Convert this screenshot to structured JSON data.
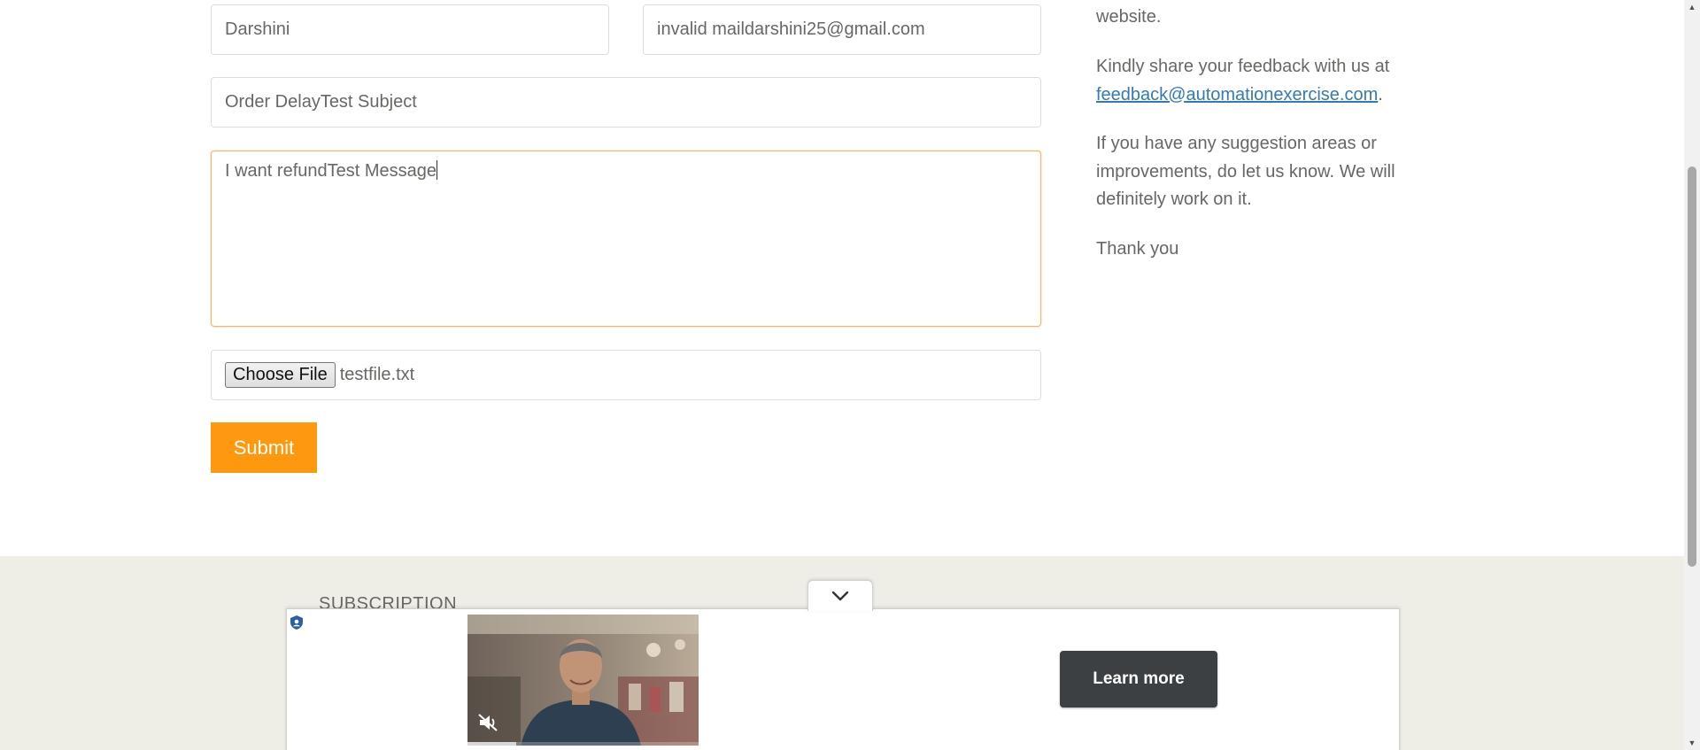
{
  "form": {
    "name_value": "Darshini",
    "email_value": "invalid maildarshini25@gmail.com",
    "subject_value": "Order DelayTest Subject",
    "message_value": "I want refundTest Message",
    "choose_file_label": "Choose File",
    "file_name": "testfile.txt",
    "submit_label": "Submit"
  },
  "info": {
    "line_website": "website.",
    "feedback_prefix": "Kindly share your feedback with us at",
    "feedback_email": "feedback@automationexercise.com",
    "feedback_suffix": ".",
    "suggestion_text": "If you have any suggestion areas or improvements, do let us know. We will definitely work on it.",
    "thanks": "Thank you"
  },
  "footer": {
    "subscription_heading": "SUBSCRIPTION"
  },
  "ad": {
    "learn_more_label": "Learn more",
    "video_progress": 0.21,
    "muted": true
  },
  "colors": {
    "accent": "#fe980f",
    "focus_border": "#fdb45e",
    "link": "#337ab7",
    "footer_bg": "#eeeee6",
    "ad_button": "#3c4043"
  },
  "icons": {
    "collapse": "chevron-down-icon",
    "privacy": "ad-privacy-shield-icon",
    "mute": "speaker-muted-icon"
  }
}
